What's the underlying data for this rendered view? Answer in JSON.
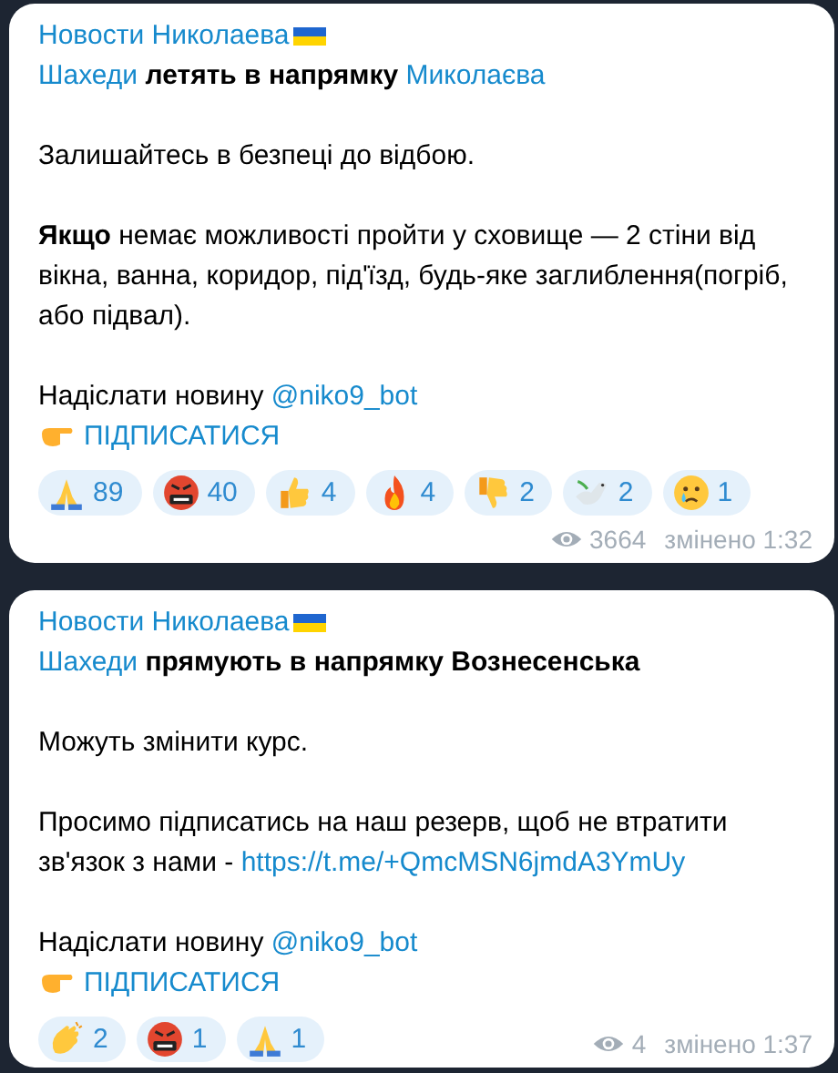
{
  "messages": [
    {
      "channel": "Новости Николаева",
      "blocks": [
        [
          [
            {
              "kind": "link",
              "text": "Шахеди"
            },
            {
              "kind": "bold",
              "text": " летять в напрямку "
            },
            {
              "kind": "link",
              "text": "Миколаєва"
            }
          ]
        ],
        [
          [
            {
              "kind": "text",
              "text": "Залишайтесь в безпеці до відбою."
            }
          ]
        ],
        [
          [
            {
              "kind": "text",
              "text": "**Якщо** немає можливості пройти у сховище — 2 стіни від вікна, ванна, коридор, під'їзд, будь-яке заглиблення(погріб, або підвал)."
            }
          ]
        ],
        [
          [
            {
              "kind": "text",
              "text": "Надіслати новину "
            },
            {
              "kind": "link",
              "text": "@niko9_bot"
            }
          ],
          [
            {
              "kind": "pointer"
            },
            {
              "kind": "link",
              "text": "ПІДПИСАТИСЯ"
            }
          ]
        ]
      ],
      "reactions": [
        {
          "kind": "pray",
          "count": "89"
        },
        {
          "kind": "rage",
          "count": "40"
        },
        {
          "kind": "thumbsup",
          "count": "4"
        },
        {
          "kind": "fire",
          "count": "4"
        },
        {
          "kind": "thumbsdown",
          "count": "2"
        },
        {
          "kind": "dove",
          "count": "2"
        },
        {
          "kind": "cry",
          "count": "1"
        }
      ],
      "views": "3664",
      "edited": "змінено 1:32"
    },
    {
      "channel": "Новости Николаева",
      "blocks": [
        [
          [
            {
              "kind": "link",
              "text": "Шахеди"
            },
            {
              "kind": "bold",
              "text": " прямують в напрямку Вознесенська"
            }
          ]
        ],
        [
          [
            {
              "kind": "text",
              "text": "Можуть змінити курс."
            }
          ]
        ],
        [
          [
            {
              "kind": "text",
              "text": "Просимо підписатись на наш резерв, щоб не втратити зв'язок з нами - "
            },
            {
              "kind": "link",
              "text": "https://t.me/+QmcMSN6jmdA3YmUy"
            }
          ]
        ],
        [
          [
            {
              "kind": "text",
              "text": "Надіслати новину "
            },
            {
              "kind": "link",
              "text": "@niko9_bot"
            }
          ],
          [
            {
              "kind": "pointer"
            },
            {
              "kind": "link",
              "text": "ПІДПИСАТИСЯ"
            }
          ]
        ]
      ],
      "reactions": [
        {
          "kind": "clap",
          "count": "2"
        },
        {
          "kind": "rage",
          "count": "1"
        },
        {
          "kind": "pray",
          "count": "1"
        }
      ],
      "views": "4",
      "edited": "змінено 1:37"
    }
  ]
}
